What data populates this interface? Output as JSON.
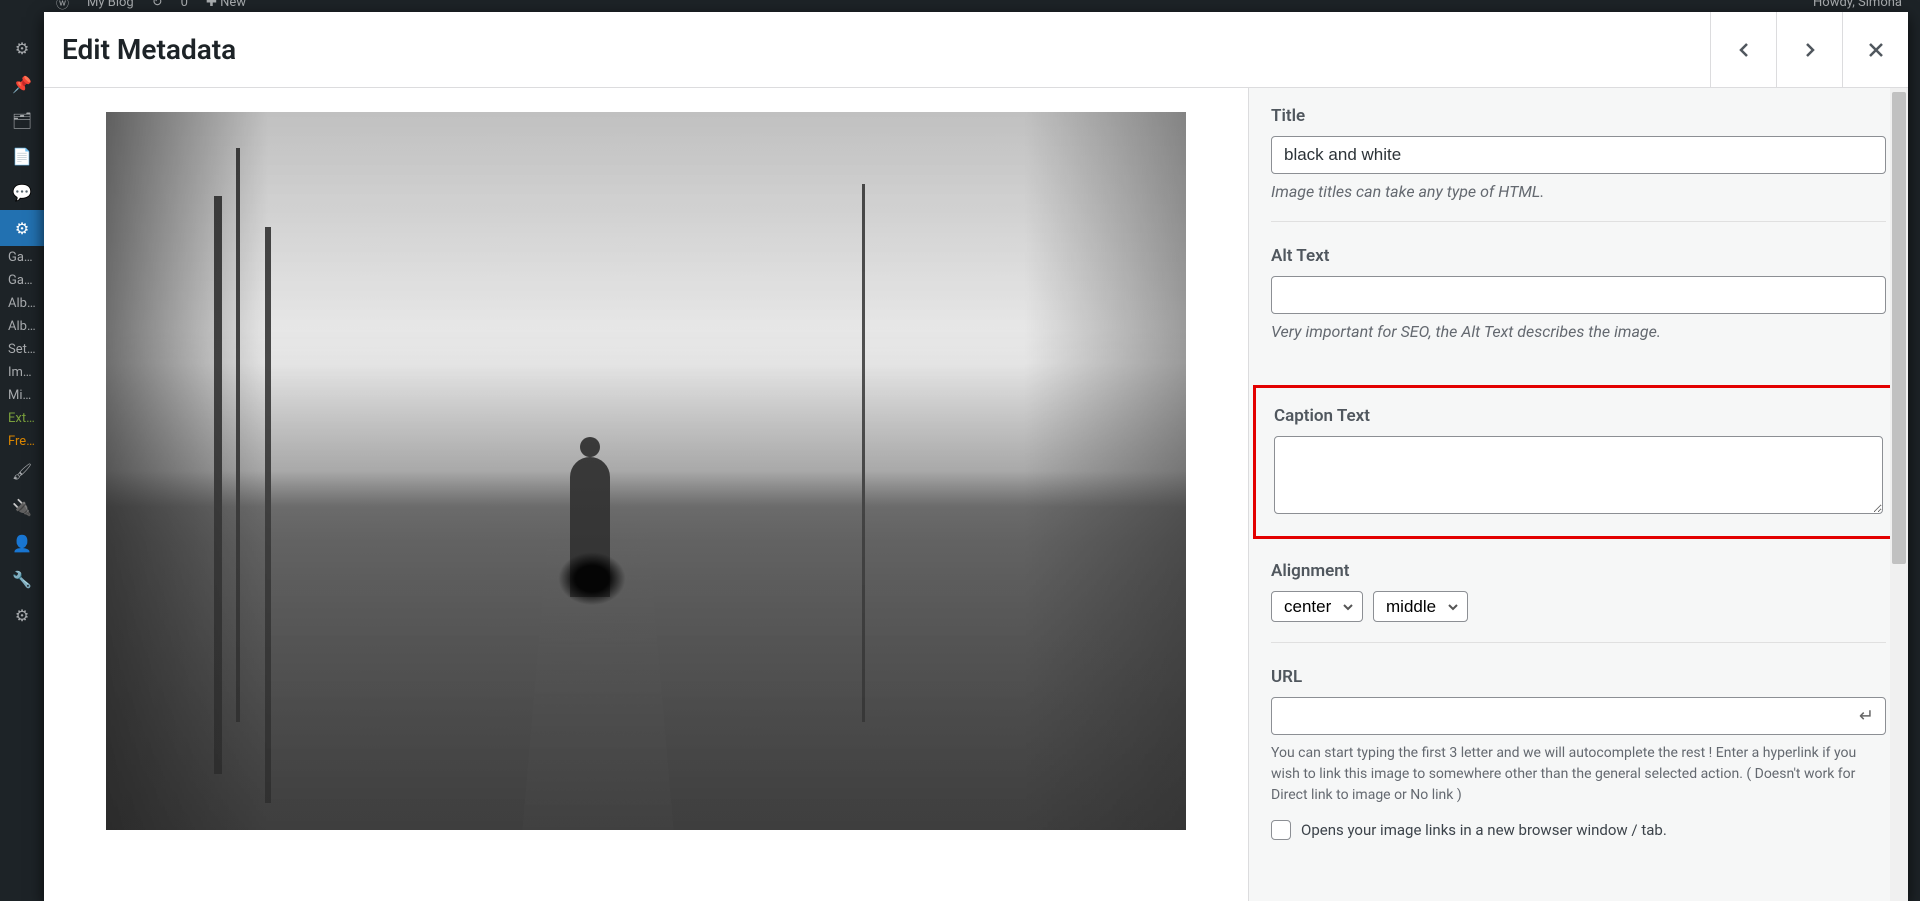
{
  "adminbar": {
    "site_name": "My Blog",
    "updates_icon": "↻",
    "comments_count": "0",
    "new_label": "New",
    "howdy": "Howdy, Simona"
  },
  "sidebar": {
    "items": [
      "Ga…",
      "Ga…",
      "Alb…",
      "Alb…",
      "Set…",
      "Im…",
      "Mi…",
      "Ext…",
      "Fre…"
    ]
  },
  "modal": {
    "title": "Edit Metadata"
  },
  "form": {
    "title": {
      "label": "Title",
      "value": "black and white",
      "hint": "Image titles can take any type of HTML."
    },
    "alt": {
      "label": "Alt Text",
      "value": "",
      "hint": "Very important for SEO, the Alt Text describes the image."
    },
    "caption": {
      "label": "Caption Text",
      "value": ""
    },
    "alignment": {
      "label": "Alignment",
      "horizontal": "center",
      "vertical": "middle"
    },
    "url": {
      "label": "URL",
      "value": "",
      "hint": "You can start typing the first 3 letter and we will autocomplete the rest ! Enter a hyperlink if you wish to link this image to somewhere other than the general selected action. ( Doesn't work for Direct link to image or No link )",
      "checkbox_label": "Opens your image links in a new browser window / tab."
    }
  }
}
